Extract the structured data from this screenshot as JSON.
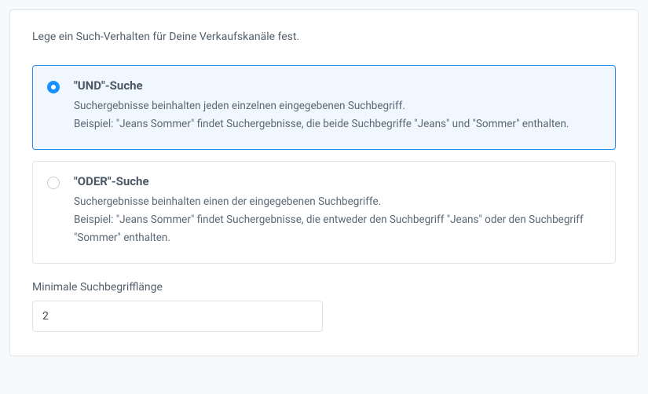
{
  "intro": "Lege ein Such-Verhalten für Deine Verkaufskanäle fest.",
  "options": {
    "und": {
      "title": "\"UND\"-Suche",
      "line1": "Suchergebnisse beinhalten jeden einzelnen eingegebenen Suchbegriff.",
      "line2": "Beispiel: \"Jeans Sommer\" findet Suchergebnisse, die beide Suchbegriffe \"Jeans\" und \"Sommer\" enthalten."
    },
    "oder": {
      "title": "\"ODER\"-Suche",
      "line1": "Suchergebnisse beinhalten einen der eingegebenen Suchbegriffe.",
      "line2": "Beispiel: \"Jeans Sommer\" findet Suchergebnisse, die entweder den Suchbegriff \"Jeans\" oder den Suchbegriff \"Sommer\" enthalten."
    }
  },
  "minLength": {
    "label": "Minimale Suchbegrifflänge",
    "value": "2"
  }
}
